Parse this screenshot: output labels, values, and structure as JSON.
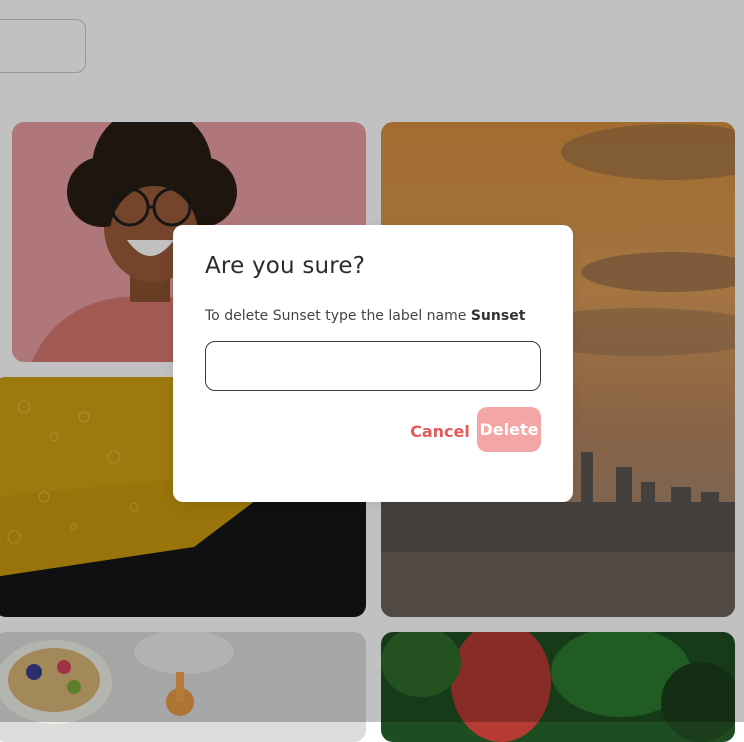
{
  "dialog": {
    "title": "Are you sure?",
    "description_prefix": "To delete Sunset type the label name ",
    "label_name": "Sunset",
    "input_value": "",
    "cancel_label": "Cancel",
    "delete_label": "Delete"
  },
  "colors": {
    "overlay": "rgba(0,0,0,0.25)",
    "cancel_text": "#e35b5b",
    "delete_button_disabled": "#f4a5a5"
  },
  "gallery": {
    "images": [
      {
        "name": "portrait-woman-pink"
      },
      {
        "name": "city-skyline-sunset"
      },
      {
        "name": "citrus-bubbles"
      },
      {
        "name": "food-bowl-table"
      },
      {
        "name": "green-leaves"
      }
    ]
  }
}
